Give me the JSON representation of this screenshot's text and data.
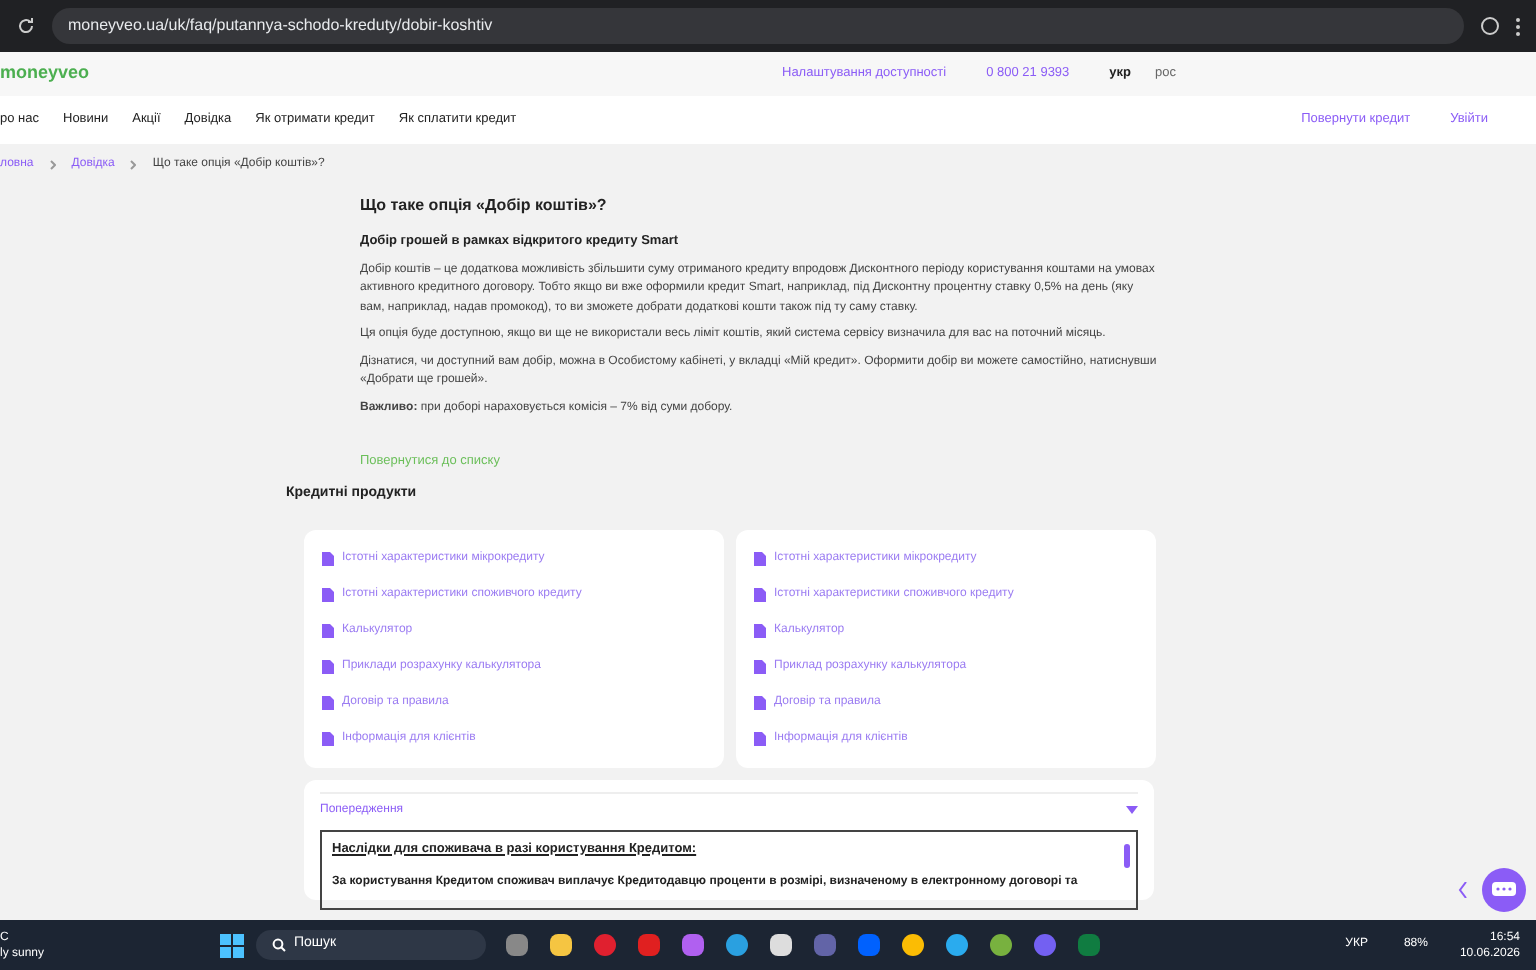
{
  "browser": {
    "url": "moneyveo.ua/uk/faq/putannya-schodo-kreduty/dobir-koshtiv"
  },
  "header": {
    "logo": "moneyveo",
    "accessibility": "Налаштування доступності",
    "phone": "0 800 21 9393",
    "languages": [
      {
        "label": "укр",
        "selected": true
      },
      {
        "label": "рос",
        "selected": false
      }
    ]
  },
  "nav": {
    "items": [
      "ро нас",
      "Новини",
      "Акції",
      "Довідка",
      "Як отримати кредит",
      "Як сплатити кредит"
    ],
    "repay": "Повернути кредит",
    "login": "Увійти"
  },
  "breadcrumb": [
    "ловна",
    "Довідка",
    "Що таке опція «Добір коштів»?"
  ],
  "article": {
    "title": "Що таке опція «Добір коштів»?",
    "subtitle": "Добір грошей в рамках відкритого кредиту Smart",
    "paragraphs": [
      "Добір коштів – це додаткова можливість збільшити суму отриманого кредиту впродовж Дисконтного періоду користування коштами на умовах активного кредитного договору. Тобто якщо ви вже оформили кредит Smart, наприклад, під Дисконтну процентну ставку 0,5% на день (яку вам, наприклад, надав промокод), то ви зможете добрати додаткові кошти також під ту саму ставку.",
      "Ця опція буде доступною, якщо ви ще не використали весь ліміт коштів, який система сервісу визначила для вас на поточний місяць.",
      "Дізнатися, чи доступний вам добір, можна в Особистому кабінеті, у вкладці «Мій кредит». Оформити добір ви можете самостійно, натиснувши «Добрати ще грошей».",
      "**Важливо:** при доборі нараховується комісія – 7% від суми добору."
    ],
    "back_link": "Повернутися до списку"
  },
  "products": {
    "title": "Кредитні продукти",
    "cards": [
      {
        "links": [
          "Істотні характеристики мікрокредиту",
          "Істотні характеристики споживчого кредиту",
          "Калькулятор",
          "Приклади розрахунку калькулятора",
          "Договір та правила",
          "Інформація для клієнтів"
        ]
      },
      {
        "links": [
          "Істотні характеристики мікрокредиту",
          "Істотні характеристики споживчого кредиту",
          "Калькулятор",
          "Приклад розрахунку калькулятора",
          "Договір та правила",
          "Інформація для клієнтів"
        ]
      }
    ]
  },
  "warning": {
    "title": "Попередження",
    "expanded": true,
    "heading": "Наслідки для споживача в разі користування Кредитом:",
    "text": "За користування Кредитом споживач виплачує Кредитодавцю проценти в розмірі, визначеному в електронному договорі та"
  },
  "taskbar": {
    "weather_temp": "C",
    "weather_text": "ly sunny",
    "search": "Пошук",
    "language": "УКР",
    "battery": "88%",
    "time": "16:54",
    "date": "10.06.2026"
  }
}
